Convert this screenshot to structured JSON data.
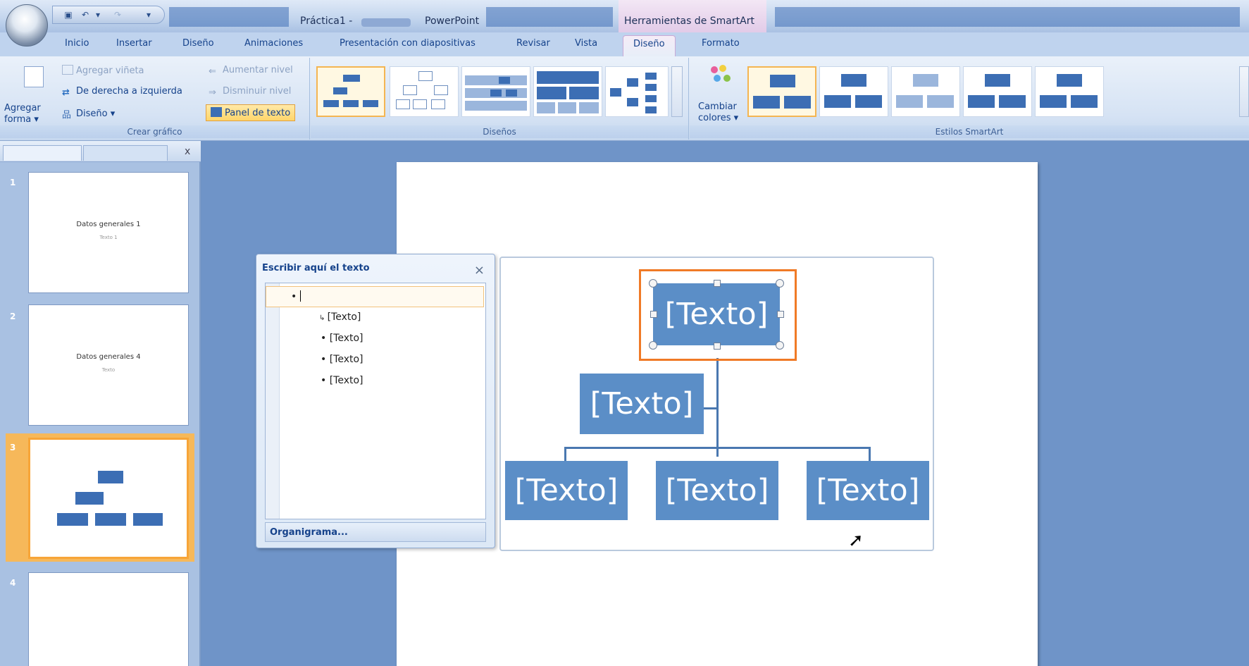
{
  "titlebar": {
    "doc_name": "Práctica1 -",
    "app_name": "PowerPoint",
    "context_tab_title": "Herramientas de SmartArt"
  },
  "tabs": {
    "inicio": "Inicio",
    "insertar": "Insertar",
    "diseno": "Diseño",
    "animaciones": "Animaciones",
    "presentacion": "Presentación con diapositivas",
    "revisar": "Revisar",
    "vista": "Vista",
    "smartart_diseno": "Diseño",
    "formato": "Formato"
  },
  "ribbon": {
    "crear_grafico": {
      "label": "Crear gráfico",
      "agregar_forma_line1": "Agregar",
      "agregar_forma_line2": "forma ▾",
      "agregar_vineta": "Agregar viñeta",
      "derecha_izquierda": "De derecha a izquierda",
      "diseno": "Diseño ▾",
      "aumentar_nivel": "Aumentar nivel",
      "disminuir_nivel": "Disminuir nivel",
      "panel_texto": "Panel de texto"
    },
    "disenos": {
      "label": "Diseños"
    },
    "estilos": {
      "label": "Estilos SmartArt",
      "cambiar_colores_line1": "Cambiar",
      "cambiar_colores_line2": "colores ▾"
    }
  },
  "slides": [
    {
      "num": "1",
      "title": "Datos generales 1",
      "subtitle": "Texto 1"
    },
    {
      "num": "2",
      "title": "Datos generales 4",
      "subtitle": "Texto"
    },
    {
      "num": "3",
      "title": "",
      "subtitle": ""
    },
    {
      "num": "4",
      "title": "",
      "subtitle": ""
    }
  ],
  "text_pane": {
    "title": "Escribir aquí el texto",
    "close": "×",
    "items": [
      "•",
      "[Texto]",
      "• [Texto]",
      "• [Texto]",
      "• [Texto]"
    ],
    "footer": "Organigrama..."
  },
  "smartart": {
    "top": "[Texto]",
    "assistant": "[Texto]",
    "bottom": [
      "[Texto]",
      "[Texto]",
      "[Texto]"
    ]
  },
  "colors": {
    "shape_fill": "#5b8ec7",
    "selection": "#f07a26",
    "ribbon_highlight": "#ffd56a"
  }
}
